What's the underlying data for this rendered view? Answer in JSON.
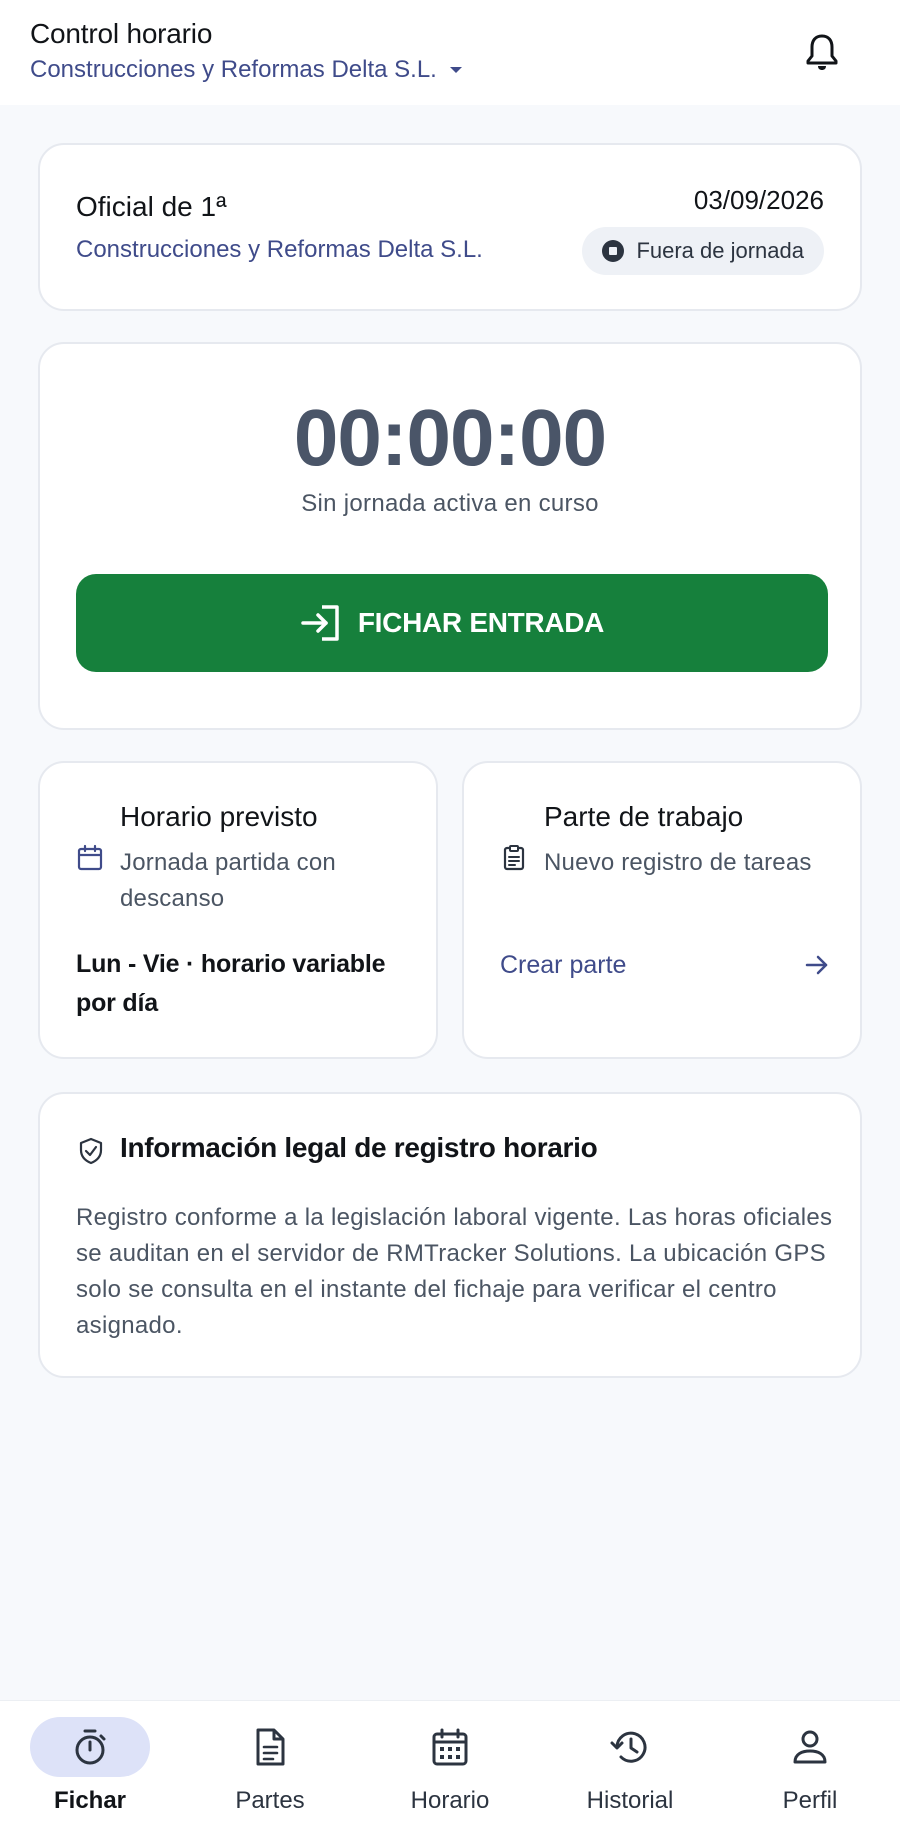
{
  "header": {
    "title": "Control horario",
    "company": "Construcciones y Reformas Delta S.L.",
    "bell_icon": "bell-icon"
  },
  "profile": {
    "role": "Oficial de 1ª",
    "company": "Construcciones y Reformas Delta S.L.",
    "date": "03/09/2026",
    "status": "Fuera de jornada"
  },
  "timer": {
    "value": "00:00:00",
    "caption": "Sin jornada activa en curso",
    "button_label": "FICHAR ENTRADA"
  },
  "schedule": {
    "title": "Horario previsto",
    "description": "Jornada partida con descanso",
    "detail": "Lun - Vie · horario variable por día"
  },
  "report": {
    "title": "Parte de trabajo",
    "description": "Nuevo registro de tareas",
    "link_label": "Crear parte"
  },
  "legal": {
    "title": "Información legal de registro horario",
    "body": "Registro conforme a la legislación laboral vigente. Las horas oficiales se auditan en el servidor de RMTracker Solutions. La ubicación GPS solo se consulta en el instante del fichaje para verificar el centro asignado."
  },
  "nav": {
    "items": [
      {
        "label": "Fichar",
        "icon": "timer-icon",
        "active": true
      },
      {
        "label": "Partes",
        "icon": "document-icon",
        "active": false
      },
      {
        "label": "Horario",
        "icon": "calendar-icon",
        "active": false
      },
      {
        "label": "Historial",
        "icon": "history-icon",
        "active": false
      },
      {
        "label": "Perfil",
        "icon": "person-icon",
        "active": false
      }
    ]
  },
  "colors": {
    "accent": "#3f4b8a",
    "primary_button": "#16803c",
    "nav_active_pill": "#dde2f8",
    "background": "#f7f9fc"
  }
}
